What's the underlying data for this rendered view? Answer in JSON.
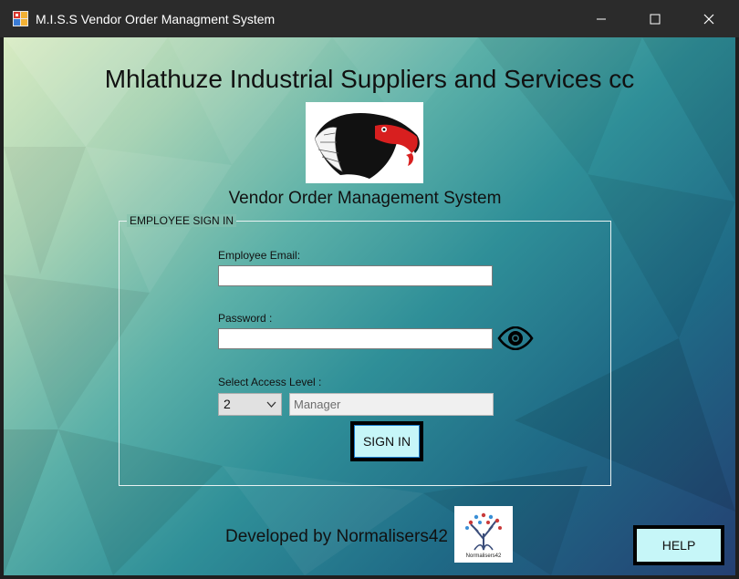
{
  "window": {
    "title": "M.I.S.S Vendor Order Managment System"
  },
  "header": {
    "company": "Mhlathuze Industrial Suppliers and Services cc",
    "system_name": "Vendor Order Management System"
  },
  "signin": {
    "group_title": "EMPLOYEE SIGN IN",
    "email_label": "Employee Email:",
    "email_value": "",
    "password_label": "Password :",
    "password_value": "",
    "access_label": "Select Access Level :",
    "access_level_value": "2",
    "access_role": "Manager",
    "signin_label": "SIGN IN"
  },
  "footer": {
    "developed_by": "Developed by Normalisers42",
    "dev_logo_caption": "Normalisers42",
    "help_label": "HELP"
  },
  "colors": {
    "button_face": "#c6f6f8",
    "button_border": "#000000",
    "titlebar": "#2b2b2b"
  }
}
